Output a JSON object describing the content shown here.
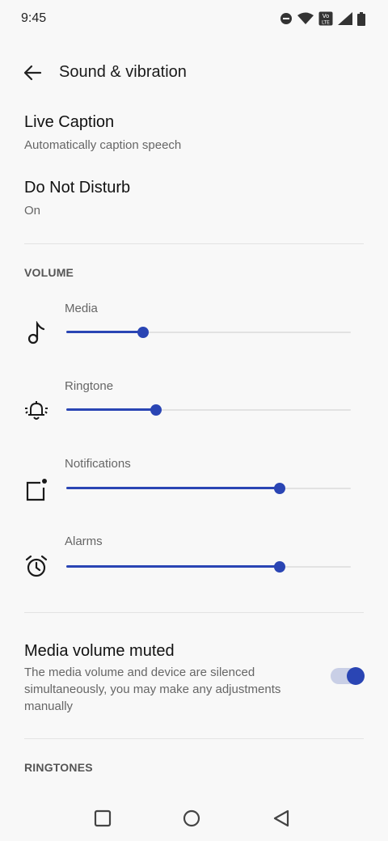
{
  "status_bar": {
    "time": "9:45",
    "icons": [
      "do-not-disturb-icon",
      "wifi-icon",
      "volte-icon",
      "cell-signal-icon",
      "battery-icon"
    ]
  },
  "app_bar": {
    "title": "Sound & vibration",
    "back_icon": "arrow-back-icon"
  },
  "prefs": {
    "live_caption": {
      "title": "Live Caption",
      "summary": "Automatically caption speech"
    },
    "dnd": {
      "title": "Do Not Disturb",
      "summary": "On"
    }
  },
  "volume": {
    "header": "VOLUME",
    "sliders": [
      {
        "label": "Media",
        "icon": "music-note-icon",
        "level": 0.27
      },
      {
        "label": "Ringtone",
        "icon": "ring-bell-icon",
        "level": 0.315
      },
      {
        "label": "Notifications",
        "icon": "notification-icon",
        "level": 0.75
      },
      {
        "label": "Alarms",
        "icon": "alarm-clock-icon",
        "level": 0.75
      }
    ]
  },
  "media_muted": {
    "title": "Media volume muted",
    "summary": "The media volume and device are silenced simultaneously, you may make any adjustments manually",
    "enabled": true
  },
  "ringtones": {
    "header": "RINGTONES"
  },
  "nav_bar": {
    "icons": [
      "recents-square-icon",
      "home-circle-icon",
      "back-triangle-icon"
    ]
  },
  "colors": {
    "accent": "#2a45b4",
    "track": "#e2e2e2",
    "background": "#f8f8f8",
    "toggle_track": "#c9cfe6"
  }
}
